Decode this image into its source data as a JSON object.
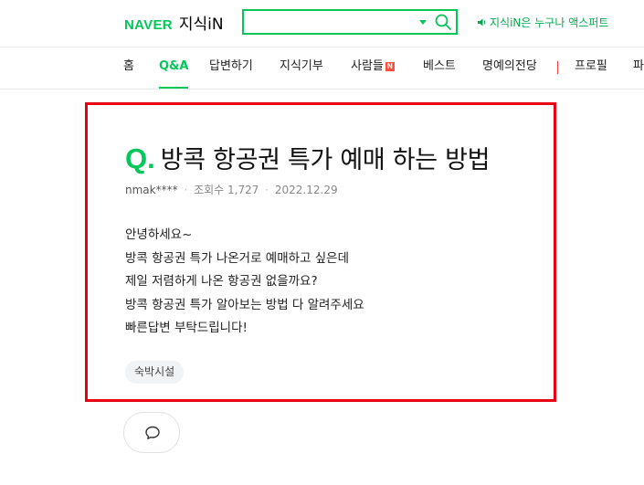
{
  "header": {
    "logo_brand": "NAVER",
    "logo_service": "지식iN",
    "search_value": "",
    "search_placeholder": "",
    "promo_text": "지식iN은 누구나 액스퍼트"
  },
  "nav": {
    "items": [
      {
        "label": "홈"
      },
      {
        "label": "Q&A",
        "active": true
      },
      {
        "label": "답변하기"
      },
      {
        "label": "지식기부"
      },
      {
        "label": "사람들",
        "badge": "N"
      },
      {
        "label": "베스트"
      },
      {
        "label": "명예의전당"
      },
      {
        "label": "프로필"
      },
      {
        "label": "파"
      }
    ]
  },
  "question": {
    "q_mark": "Q.",
    "title": "방콕 항공권 특가 예매 하는 방법",
    "author": "nmak****",
    "views_label": "조회수",
    "views": "1,727",
    "date": "2022.12.29",
    "body_lines": [
      "안녕하세요~",
      "방콕 항공권 특가 나온거로 예매하고 싶은데",
      "제일 저렴하게 나온 항공권 없을까요?",
      "방콕 항공권 특가 알아보는 방법 다 알려주세요",
      "빠른답변 부탁드립니다!"
    ],
    "tag": "숙박시설"
  },
  "colors": {
    "brand_green": "#03c75a",
    "highlight_red": "#e60012",
    "badge_red": "#ff4e3c"
  },
  "icons": {
    "search": "search-icon",
    "dropdown": "caret-down-icon",
    "promo": "speaker-icon",
    "comment": "comment-icon"
  }
}
